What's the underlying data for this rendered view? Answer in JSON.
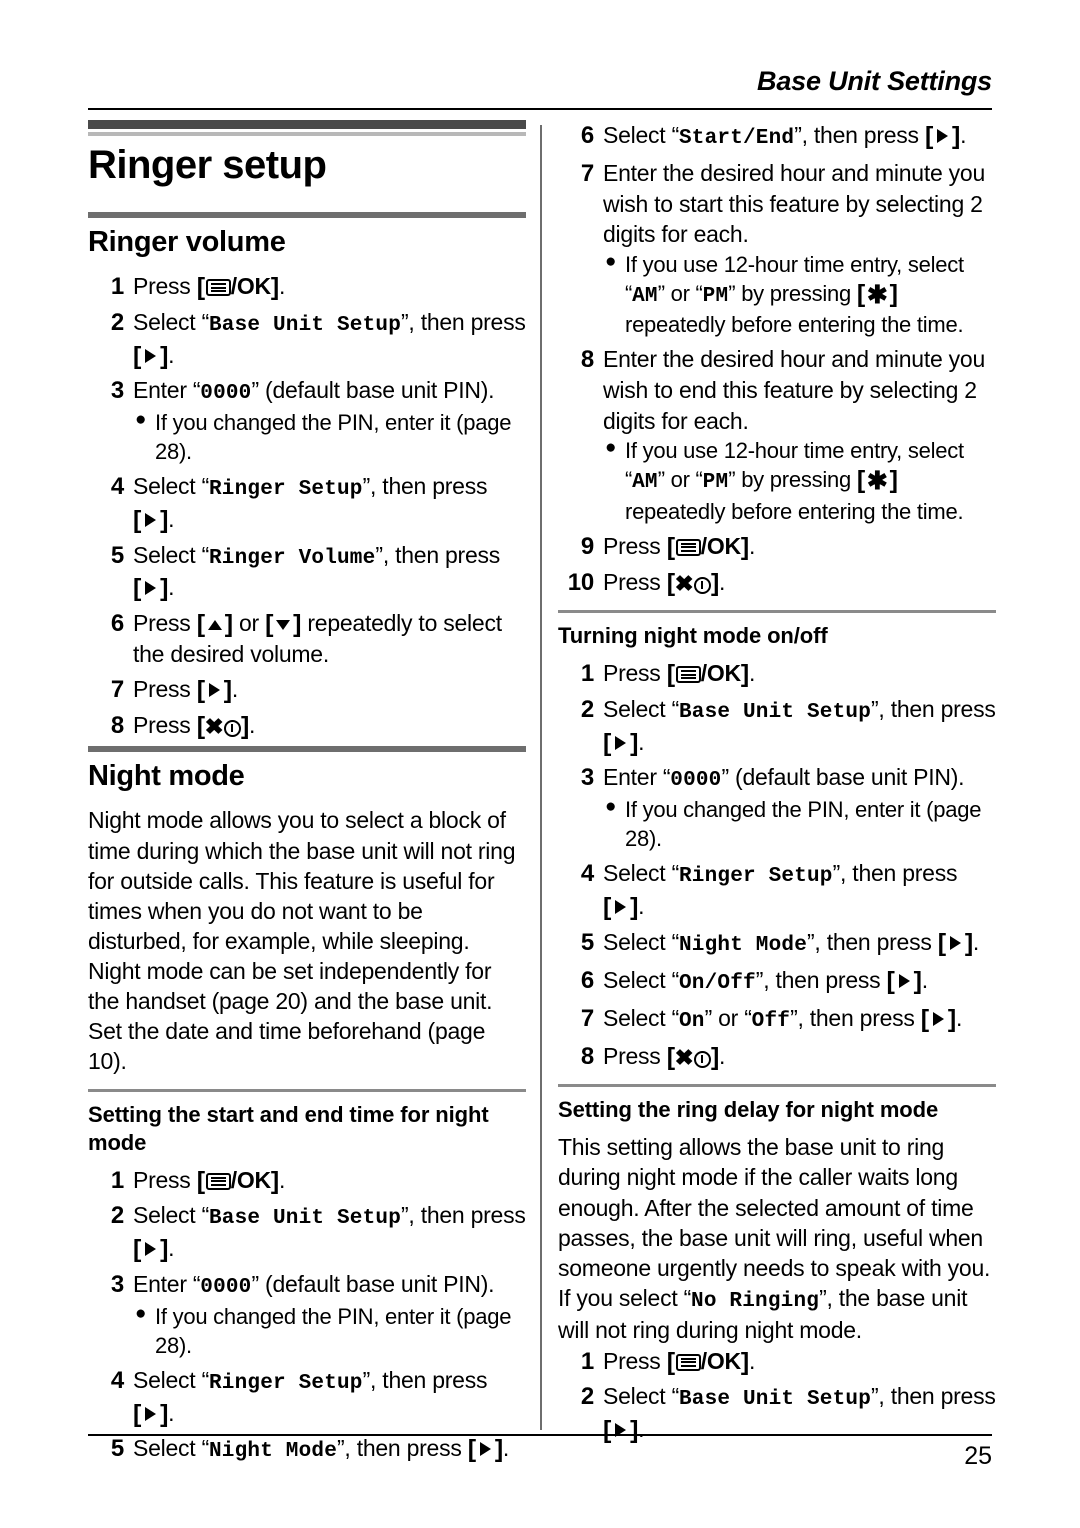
{
  "header": {
    "running_head": "Base Unit Settings"
  },
  "footer": {
    "page_number": "25"
  },
  "chapter": {
    "title": "Ringer setup"
  },
  "sections": {
    "ringer_volume": {
      "title": "Ringer volume",
      "steps": [
        {
          "num": "1",
          "pre": "Press ",
          "key": "menu-ok",
          "post": "."
        },
        {
          "num": "2",
          "pre": "Select “",
          "mono": "Base Unit Setup",
          "mid": "”, then press ",
          "key": "right",
          "post": "."
        },
        {
          "num": "3",
          "pre": "Enter “",
          "mono": "0000",
          "post": "” (default base unit PIN).",
          "note": "If you changed the PIN, enter it (page 28)."
        },
        {
          "num": "4",
          "pre": "Select “",
          "mono": "Ringer Setup",
          "mid": "”, then press ",
          "key": "right",
          "post": "."
        },
        {
          "num": "5",
          "pre": "Select “",
          "mono": "Ringer Volume",
          "mid": "”, then press ",
          "key": "right",
          "post": "."
        },
        {
          "num": "6",
          "pre": "Press ",
          "key": "up",
          "mid": " or ",
          "key2": "down",
          "post": " repeatedly to select the desired volume."
        },
        {
          "num": "7",
          "pre": "Press ",
          "key": "right",
          "post": "."
        },
        {
          "num": "8",
          "pre": "Press ",
          "key": "off-power",
          "post": "."
        }
      ]
    },
    "night_mode": {
      "title": "Night mode",
      "paragraphs": [
        "Night mode allows you to select a block of time during which the base unit will not ring for outside calls. This feature is useful for times when you do not want to be disturbed, for example, while sleeping. Night mode can be set independently for the handset (page 20) and the base unit.",
        "Set the date and time beforehand (page 10)."
      ]
    },
    "start_end_time": {
      "title": "Setting the start and end time for night mode",
      "steps": [
        {
          "num": "1",
          "pre": "Press ",
          "key": "menu-ok",
          "post": "."
        },
        {
          "num": "2",
          "pre": "Select “",
          "mono": "Base Unit Setup",
          "mid": "”, then press ",
          "key": "right",
          "post": "."
        },
        {
          "num": "3",
          "pre": "Enter “",
          "mono": "0000",
          "post": "” (default base unit PIN).",
          "note": "If you changed the PIN, enter it (page 28)."
        },
        {
          "num": "4",
          "pre": "Select “",
          "mono": "Ringer Setup",
          "mid": "”, then press ",
          "key": "right",
          "post": "."
        },
        {
          "num": "5",
          "pre": "Select “",
          "mono": "Night Mode",
          "mid": "”, then press ",
          "key": "right",
          "post": "."
        },
        {
          "num": "6",
          "pre": "Select “",
          "mono": "Start/End",
          "mid": "”, then press ",
          "key": "right",
          "post": "."
        },
        {
          "num": "7",
          "pre": "Enter the desired hour and minute you wish to start this feature by selecting 2 digits for each.",
          "note_parts": {
            "a": "If you use 12-hour time entry, select “",
            "b": "AM",
            "c": "” or “",
            "d": "PM",
            "e": "” by pressing ",
            "f": " repeatedly before entering the time."
          }
        },
        {
          "num": "8",
          "pre": "Enter the desired hour and minute you wish to end this feature by selecting 2 digits for each.",
          "note_parts": {
            "a": "If you use 12-hour time entry, select “",
            "b": "AM",
            "c": "” or “",
            "d": "PM",
            "e": "” by pressing ",
            "f": " repeatedly before entering the time."
          }
        },
        {
          "num": "9",
          "pre": "Press ",
          "key": "menu-ok",
          "post": "."
        },
        {
          "num": "10",
          "pre": "Press ",
          "key": "off-power",
          "post": "."
        }
      ]
    },
    "turning_on_off": {
      "title": "Turning night mode on/off",
      "steps": [
        {
          "num": "1",
          "pre": "Press ",
          "key": "menu-ok",
          "post": "."
        },
        {
          "num": "2",
          "pre": "Select “",
          "mono": "Base Unit Setup",
          "mid": "”, then press ",
          "key": "right",
          "post": "."
        },
        {
          "num": "3",
          "pre": "Enter “",
          "mono": "0000",
          "post": "” (default base unit PIN).",
          "note": "If you changed the PIN, enter it (page 28)."
        },
        {
          "num": "4",
          "pre": "Select “",
          "mono": "Ringer Setup",
          "mid": "”, then press ",
          "key": "right",
          "post": "."
        },
        {
          "num": "5",
          "pre": "Select “",
          "mono": "Night Mode",
          "mid": "”, then press ",
          "key": "right",
          "post": "."
        },
        {
          "num": "6",
          "pre": "Select “",
          "mono": "On/Off",
          "mid": "”, then press ",
          "key": "right",
          "post": "."
        },
        {
          "num": "7",
          "pre": "Select “",
          "mono": "On",
          "mid": "” or “",
          "mono2": "Off",
          "mid2": "”, then press ",
          "key": "right",
          "post": "."
        },
        {
          "num": "8",
          "pre": "Press ",
          "key": "off-power",
          "post": "."
        }
      ]
    },
    "ring_delay": {
      "title": "Setting the ring delay for night mode",
      "paragraph_parts": {
        "a": "This setting allows the base unit to ring during night mode if the caller waits long enough. After the selected amount of time passes, the base unit will ring, useful when someone urgently needs to speak with you. If you select “",
        "b": "No Ringing",
        "c": "”, the base unit will not ring during night mode."
      },
      "steps": [
        {
          "num": "1",
          "pre": "Press ",
          "key": "menu-ok",
          "post": "."
        },
        {
          "num": "2",
          "pre": "Select “",
          "mono": "Base Unit Setup",
          "mid": "”, then press ",
          "key": "right",
          "post": "."
        }
      ]
    }
  },
  "icons": {
    "menu_ok": "menu-ok-key",
    "right_arrow": "right-arrow-key",
    "up_arrow": "up-arrow-key",
    "down_arrow": "down-arrow-key",
    "off_power": "off-power-key",
    "star": "star-key"
  }
}
